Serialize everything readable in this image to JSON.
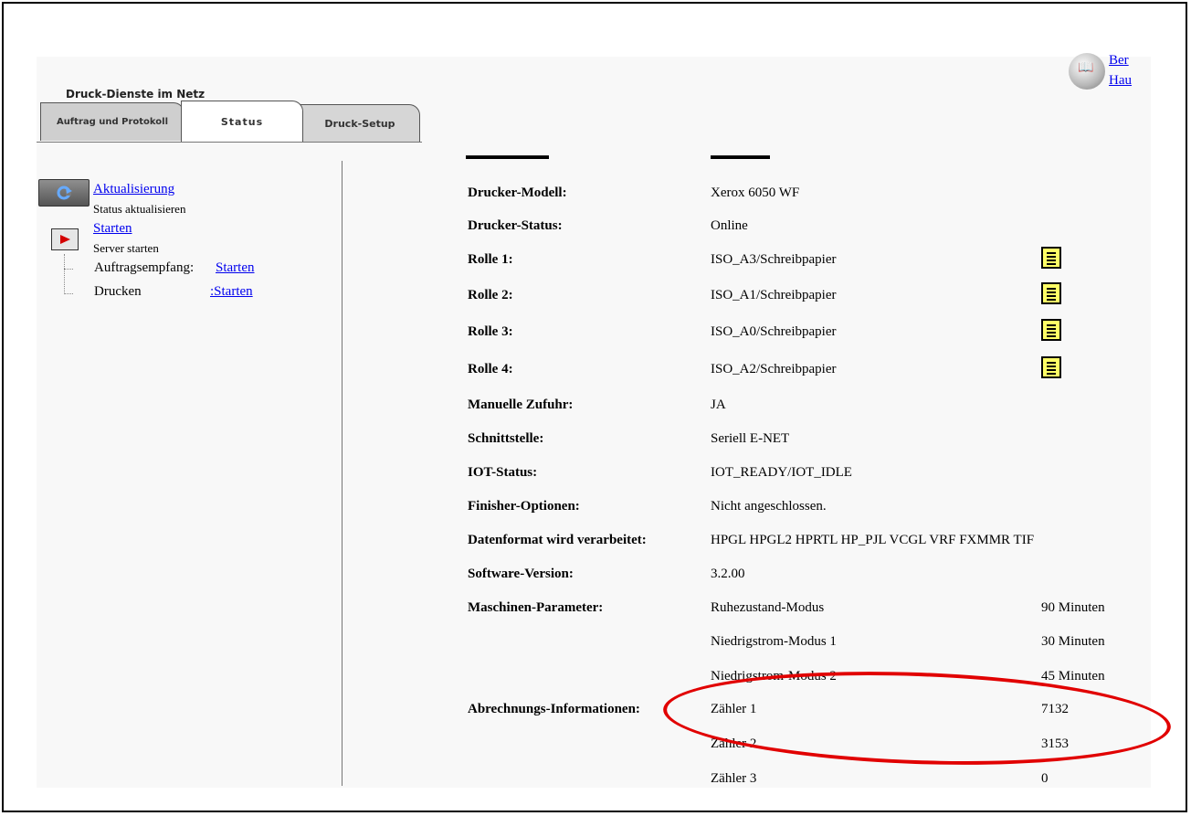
{
  "header": {
    "title": "Druck-Dienste im Netz"
  },
  "help": {
    "link1": "Ber",
    "link2": "Hau"
  },
  "tabs": [
    {
      "label": "Auftrag und Protokoll"
    },
    {
      "label": "Status"
    },
    {
      "label": "Druck-Setup"
    }
  ],
  "sidebar": {
    "refresh_link": "Aktualisierung",
    "refresh_desc": "Status aktualisieren",
    "start_link": "Starten",
    "start_desc": "Server starten",
    "sub1_label": "Auftragsempfang:",
    "sub1_link": "Starten",
    "sub2_label": "Drucken",
    "sub2_link": ":Starten"
  },
  "status_rows": [
    {
      "label": "Drucker-Modell:",
      "value": "Xerox 6050 WF"
    },
    {
      "label": "Drucker-Status:",
      "value": "Online"
    },
    {
      "label": "Rolle 1:",
      "value": "ISO_A3/Schreibpapier"
    },
    {
      "label": "Rolle 2:",
      "value": "ISO_A1/Schreibpapier"
    },
    {
      "label": "Rolle 3:",
      "value": "ISO_A0/Schreibpapier"
    },
    {
      "label": "Rolle 4:",
      "value": "ISO_A2/Schreibpapier"
    },
    {
      "label": "Manuelle Zufuhr:",
      "value": "JA"
    },
    {
      "label": "Schnittstelle:",
      "value": "Seriell E-NET"
    },
    {
      "label": "IOT-Status:",
      "value": "IOT_READY/IOT_IDLE"
    },
    {
      "label": "Finisher-Optionen:",
      "value": "Nicht angeschlossen."
    },
    {
      "label": "Datenformat wird verarbeitet:",
      "value": "HPGL HPGL2 HPRTL HP_PJL VCGL VRF FXMMR TIF"
    },
    {
      "label": "Software-Version:",
      "value": "3.2.00"
    }
  ],
  "machine_params": {
    "label": "Maschinen-Parameter:",
    "rows": [
      {
        "name": "Ruhezustand-Modus",
        "value": "90 Minuten"
      },
      {
        "name": "Niedrigstrom-Modus 1",
        "value": "30 Minuten"
      },
      {
        "name": "Niedrigstrom-Modus 2",
        "value": "45 Minuten"
      }
    ]
  },
  "billing": {
    "label": "Abrechnungs-Informationen:",
    "rows": [
      {
        "name": "Zähler 1",
        "value": "7132"
      },
      {
        "name": "Zähler 2",
        "value": "3153"
      },
      {
        "name": "Zähler 3",
        "value": "0"
      }
    ]
  },
  "annotation_color": "#e10000"
}
